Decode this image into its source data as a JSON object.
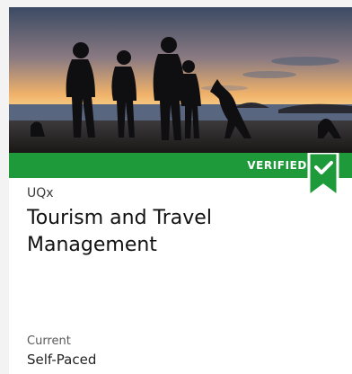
{
  "card": {
    "image_alt": "Silhouettes of people and a kangaroo on a beach at sunset",
    "badge": {
      "label": "VERIFIED",
      "icon": "check-ribbon-icon",
      "color": "#1f9a3a"
    },
    "org": "UQx",
    "title": "Tourism and Travel Management",
    "status": "Current",
    "pacing": "Self-Paced"
  }
}
